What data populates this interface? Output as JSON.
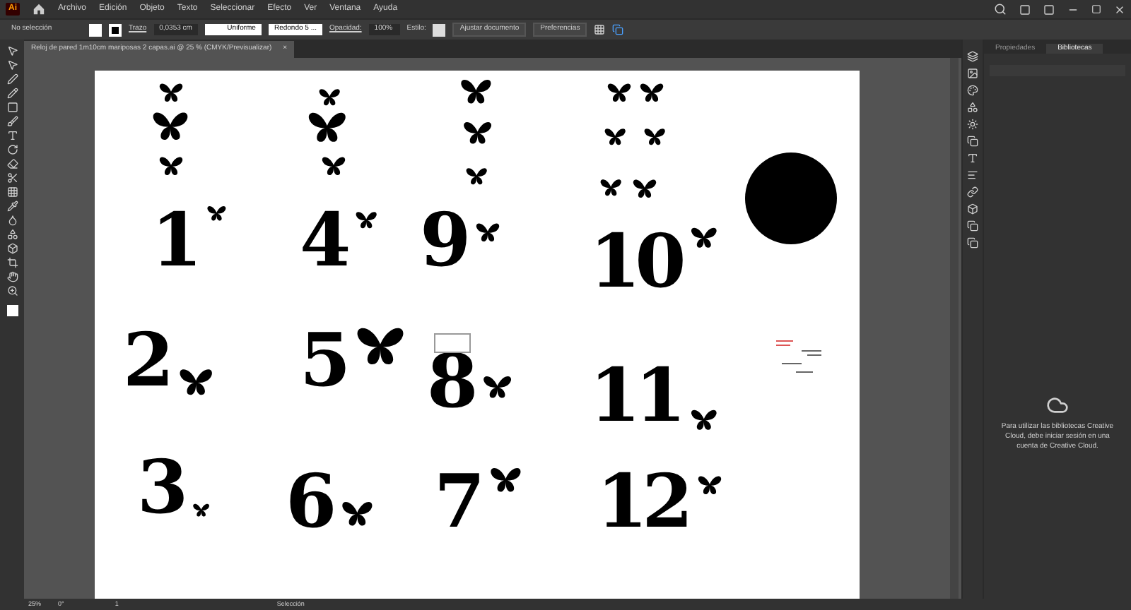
{
  "app_logo": "Ai",
  "menu": [
    "Archivo",
    "Edición",
    "Objeto",
    "Texto",
    "Seleccionar",
    "Efecto",
    "Ver",
    "Ventana",
    "Ayuda"
  ],
  "control_bar": {
    "selection": "No selección",
    "stroke_label": "Trazo",
    "stroke_weight": "0,0353 cm",
    "profile": "Uniforme",
    "brush": "Redondo 5 ...",
    "opacity_label": "Opacidad:",
    "opacity": "100%",
    "style_label": "Estilo:",
    "buttons": [
      "Ajustar documento",
      "Preferencias"
    ]
  },
  "document_tab": {
    "title": "Reloj de pared 1m10cm mariposas 2 capas.ai @ 25 % (CMYK/Previsualizar)",
    "close": "×"
  },
  "artboard": {
    "numerals": [
      "1",
      "4",
      "9",
      "10",
      "2",
      "5",
      "8",
      "11",
      "3",
      "6",
      "7",
      "12"
    ]
  },
  "panel": {
    "tabs": [
      {
        "label": "Propiedades",
        "selected": false
      },
      {
        "label": "Bibliotecas",
        "selected": true
      }
    ],
    "message": "Para utilizar las bibliotecas Creative Cloud, debe iniciar sesión en una cuenta de Creative Cloud."
  },
  "status_bar": {
    "zoom": "25%",
    "angle": "0°",
    "artboard": "1",
    "tool": "Selección"
  }
}
